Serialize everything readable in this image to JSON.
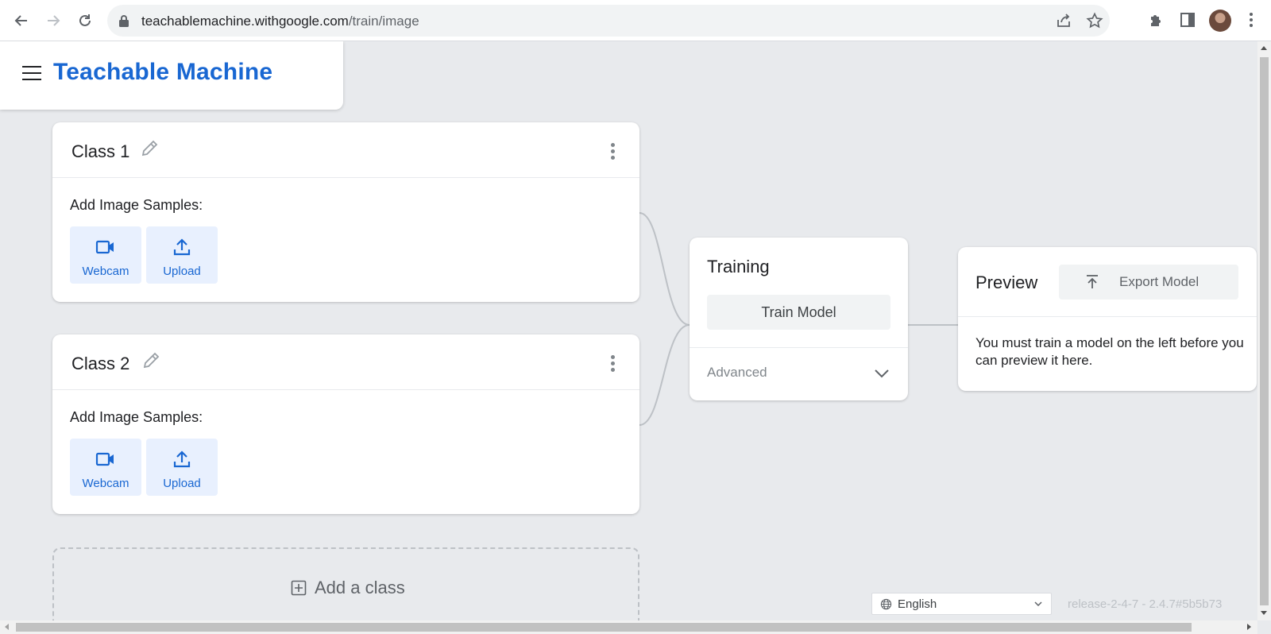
{
  "browser": {
    "url_host": "teachablemachine.withgoogle.com",
    "url_path": "/train/image"
  },
  "app": {
    "brand": "Teachable Machine"
  },
  "classes": [
    {
      "title": "Class 1",
      "samples_label": "Add Image Samples:",
      "webcam_label": "Webcam",
      "upload_label": "Upload"
    },
    {
      "title": "Class 2",
      "samples_label": "Add Image Samples:",
      "webcam_label": "Webcam",
      "upload_label": "Upload"
    }
  ],
  "add_class_label": "Add a class",
  "training": {
    "title": "Training",
    "train_button": "Train Model",
    "advanced_label": "Advanced"
  },
  "preview": {
    "title": "Preview",
    "export_button": "Export Model",
    "message": "You must train a model on the left before you can preview it here."
  },
  "footer": {
    "language": "English",
    "release": "release-2-4-7 - 2.4.7#5b5b73"
  },
  "colors": {
    "brand_blue": "#1967d2",
    "sample_button_bg": "#e8f0fe",
    "page_bg": "#e8eaed"
  }
}
